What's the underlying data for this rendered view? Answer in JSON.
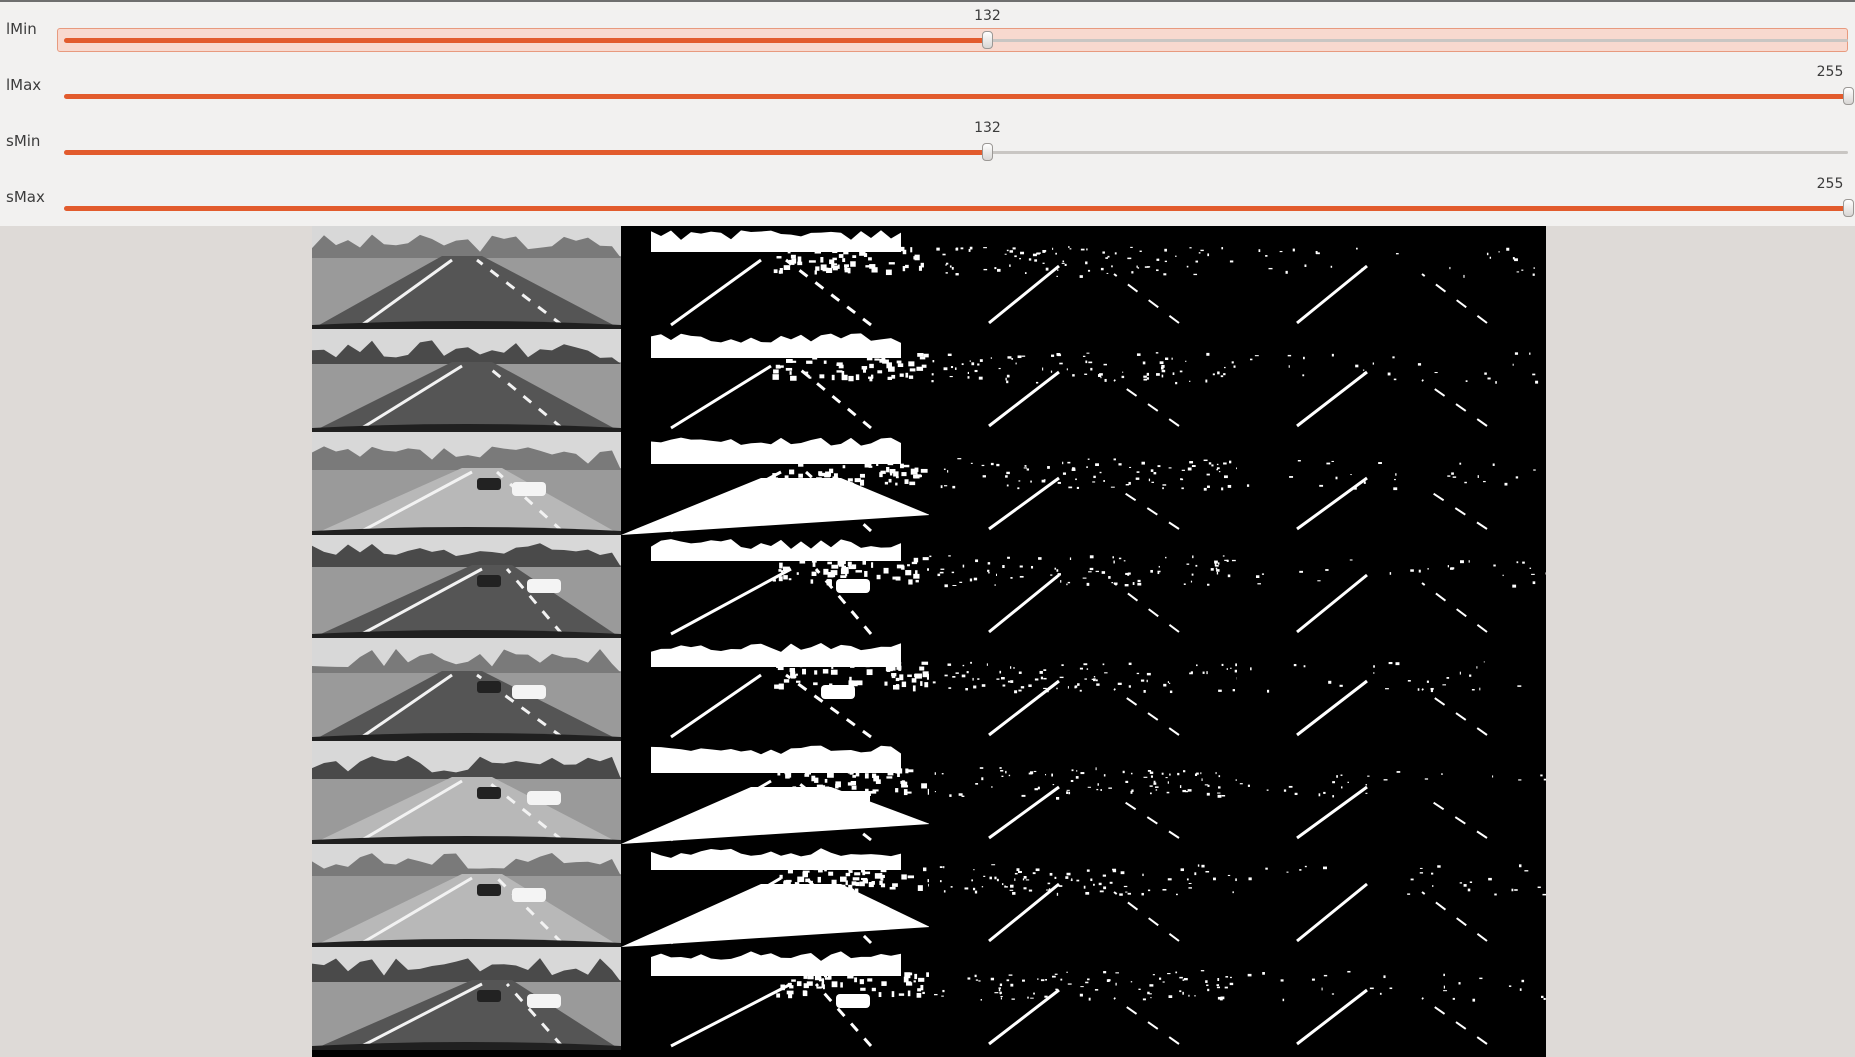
{
  "sliders": [
    {
      "id": "lMin",
      "label": "lMin",
      "value": 132,
      "max": 255,
      "focused": true
    },
    {
      "id": "lMax",
      "label": "lMax",
      "value": 255,
      "max": 255,
      "focused": false
    },
    {
      "id": "sMin",
      "label": "sMin",
      "value": 132,
      "max": 255,
      "focused": false
    },
    {
      "id": "sMax",
      "label": "sMax",
      "value": 255,
      "max": 255,
      "focused": false
    }
  ],
  "image_grid": {
    "columns": [
      "grayscale",
      "lightness-threshold",
      "saturation-threshold",
      "combined-threshold"
    ],
    "rows": 8
  },
  "colors": {
    "accent": "#e25b2d",
    "panel": "#f2f1f0",
    "background": "#dedad7",
    "image_bg": "#000000"
  }
}
